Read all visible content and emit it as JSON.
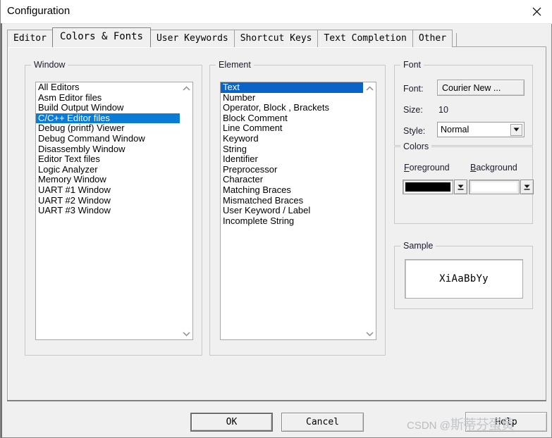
{
  "window": {
    "title": "Configuration",
    "close_icon": "close-x-icon"
  },
  "tabs": [
    {
      "label": "Editor",
      "selected": false
    },
    {
      "label": "Colors & Fonts",
      "selected": true
    },
    {
      "label": "User Keywords",
      "selected": false
    },
    {
      "label": "Shortcut Keys",
      "selected": false
    },
    {
      "label": "Text Completion",
      "selected": false
    },
    {
      "label": "Other",
      "selected": false
    }
  ],
  "window_group": {
    "title": "Window",
    "items": [
      "All Editors",
      "Asm Editor files",
      "Build Output Window",
      "C/C++ Editor files",
      "Debug (printf) Viewer",
      "Debug Command Window",
      "Disassembly Window",
      "Editor Text files",
      "Logic Analyzer",
      "Memory Window",
      "UART #1 Window",
      "UART #2 Window",
      "UART #3 Window"
    ],
    "selected_index": 3,
    "selection_color": "#0a7cd8",
    "scroll_up_icon": "chevron-up-icon",
    "scroll_down_icon": "chevron-down-icon"
  },
  "element_group": {
    "title": "Element",
    "items": [
      "Text",
      "Number",
      "Operator, Block , Brackets",
      "Block Comment",
      "Line Comment",
      "Keyword",
      "String",
      "Identifier",
      "Preprocessor",
      "Character",
      "Matching Braces",
      "Mismatched Braces",
      "User Keyword / Label",
      "Incomplete String"
    ],
    "selected_index": 0,
    "selection_color": "#0a64c8",
    "scroll_up_icon": "chevron-up-icon",
    "scroll_down_icon": "chevron-down-icon"
  },
  "font_group": {
    "title": "Font",
    "font_label": "Font:",
    "font_value": "Courier New ...",
    "size_label": "Size:",
    "size_value": "10",
    "style_label": "Style:",
    "style_value": "Normal",
    "style_dropdown_icon": "triangle-down-icon"
  },
  "colors_group": {
    "title": "Colors",
    "foreground_label": "Foreground",
    "foreground_accel": "F",
    "foreground_color": "#000000",
    "background_label": "Background",
    "background_accel": "B",
    "background_color": "#ffffff",
    "dropdown_icon": "color-dropdown-icon"
  },
  "sample_group": {
    "title": "Sample",
    "text": "XiAaBbYy",
    "background": "#ffffff",
    "foreground": "#000000"
  },
  "buttons": {
    "ok": "OK",
    "cancel": "Cancel",
    "help": "Help"
  },
  "watermark": {
    "prefix": "CSDN @",
    "name": "斯蒂芬蛋黄"
  }
}
